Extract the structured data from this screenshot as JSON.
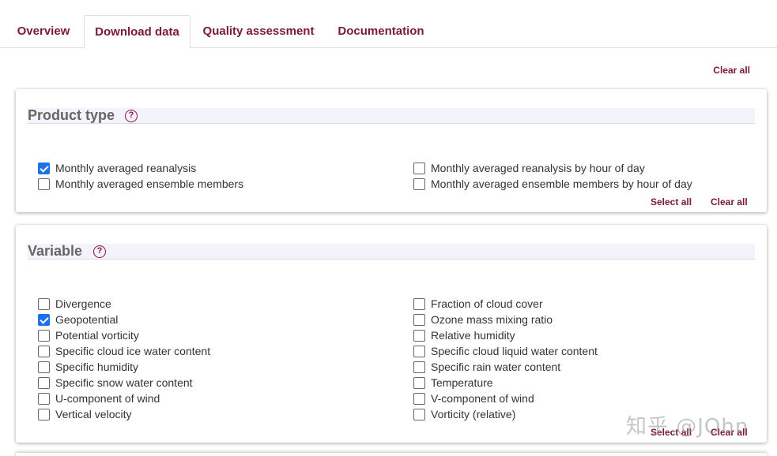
{
  "tabs": [
    {
      "label": "Overview",
      "active": false
    },
    {
      "label": "Download data",
      "active": true
    },
    {
      "label": "Quality assessment",
      "active": false
    },
    {
      "label": "Documentation",
      "active": false
    }
  ],
  "clear_all_label": "Clear all",
  "product_type": {
    "title": "Product type",
    "help_glyph": "?",
    "options_left": [
      {
        "label": "Monthly averaged reanalysis",
        "checked": true
      },
      {
        "label": "Monthly averaged ensemble members",
        "checked": false
      }
    ],
    "options_right": [
      {
        "label": "Monthly averaged reanalysis by hour of day",
        "checked": false
      },
      {
        "label": "Monthly averaged ensemble members by hour of day",
        "checked": false
      }
    ],
    "select_all_label": "Select all",
    "clear_all_label": "Clear all"
  },
  "variable": {
    "title": "Variable",
    "help_glyph": "?",
    "options_left": [
      {
        "label": "Divergence",
        "checked": false
      },
      {
        "label": "Geopotential",
        "checked": true
      },
      {
        "label": "Potential vorticity",
        "checked": false
      },
      {
        "label": "Specific cloud ice water content",
        "checked": false
      },
      {
        "label": "Specific humidity",
        "checked": false
      },
      {
        "label": "Specific snow water content",
        "checked": false
      },
      {
        "label": "U-component of wind",
        "checked": false
      },
      {
        "label": "Vertical velocity",
        "checked": false
      }
    ],
    "options_right": [
      {
        "label": "Fraction of cloud cover",
        "checked": false
      },
      {
        "label": "Ozone mass mixing ratio",
        "checked": false
      },
      {
        "label": "Relative humidity",
        "checked": false
      },
      {
        "label": "Specific cloud liquid water content",
        "checked": false
      },
      {
        "label": "Specific rain water content",
        "checked": false
      },
      {
        "label": "Temperature",
        "checked": false
      },
      {
        "label": "V-component of wind",
        "checked": false
      },
      {
        "label": "Vorticity (relative)",
        "checked": false
      }
    ],
    "select_all_label": "Select all",
    "clear_all_label": "Clear all"
  },
  "watermark": "知乎 @JOhn",
  "colors": {
    "accent": "#7a1a32",
    "checkbox_on": "#1a73e8"
  }
}
